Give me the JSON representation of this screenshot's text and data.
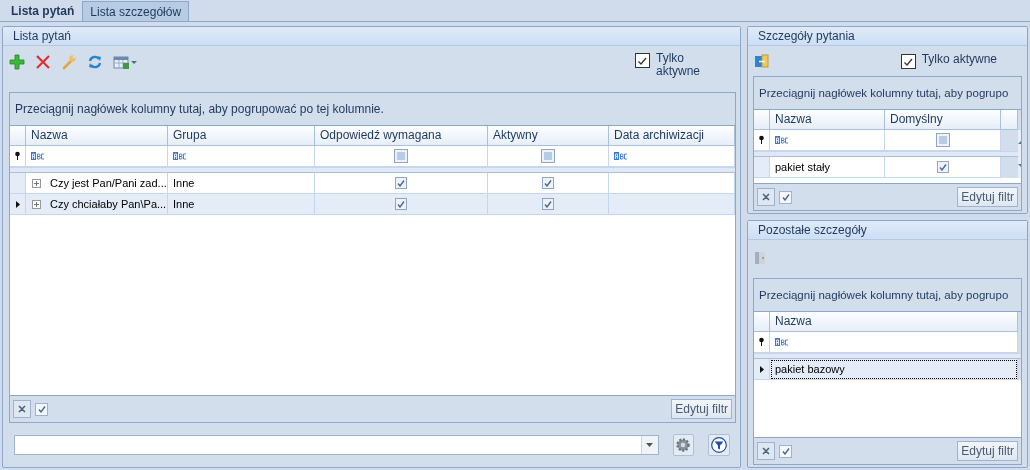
{
  "tabs": [
    {
      "label": "Lista pytań",
      "selected": true
    },
    {
      "label": "Lista szczegółów",
      "selected": false
    }
  ],
  "questions_panel": {
    "title": "Lista pytań",
    "only_active": {
      "label": "Tylko aktywne",
      "checked": true
    },
    "grid": {
      "group_hint": "Przeciągnij nagłówek kolumny tutaj, aby pogrupować po tej kolumnie.",
      "columns": [
        {
          "label": "Nazwa",
          "kind": "text"
        },
        {
          "label": "Grupa",
          "kind": "text"
        },
        {
          "label": "Odpowiedź wymagana",
          "kind": "check",
          "filter_indeterminate": true
        },
        {
          "label": "Aktywny",
          "kind": "check",
          "filter_indeterminate": true
        },
        {
          "label": "Data archiwizacji",
          "kind": "text"
        }
      ],
      "rows": [
        {
          "selected": false,
          "expanded": false,
          "cells": [
            "Czy jest Pan/Pani zad...",
            "Inne",
            true,
            true
          ]
        },
        {
          "selected": true,
          "expanded": false,
          "cells": [
            "Czy chciałaby Pan\\Pa...",
            "Inne",
            true,
            true
          ]
        }
      ],
      "filter_enabled": true,
      "edit_filter": "Edytuj filtr"
    }
  },
  "question_details": {
    "title": "Szczegóły pytania",
    "only_active": {
      "label": "Tylko aktywne",
      "checked": true
    },
    "grid": {
      "group_hint": "Przeciągnij nagłówek kolumny tutaj, aby pogrupo",
      "columns": [
        {
          "label": "Nazwa",
          "kind": "text"
        },
        {
          "label": "Domyślny",
          "kind": "check",
          "filter_indeterminate": true
        }
      ],
      "rows": [
        {
          "selected": false,
          "cells": [
            "pakiet stały",
            true
          ]
        }
      ],
      "filter_enabled": true,
      "edit_filter": "Edytuj filtr"
    }
  },
  "other_details": {
    "title": "Pozostałe szczegóły",
    "grid": {
      "group_hint": "Przeciągnij nagłówek kolumny tutaj, aby pogrupo",
      "columns": [
        {
          "label": "Nazwa",
          "kind": "text"
        }
      ],
      "rows": [
        {
          "selected": true,
          "cells": [
            "pakiet bazowy"
          ]
        }
      ],
      "filter_enabled": true,
      "edit_filter": "Edytuj filtr"
    }
  }
}
